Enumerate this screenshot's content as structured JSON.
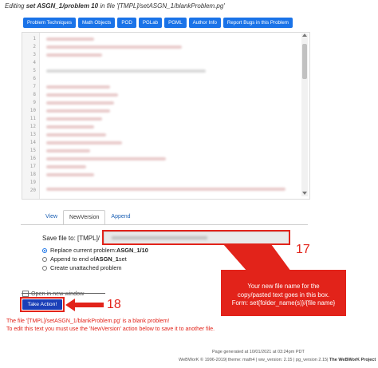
{
  "header": {
    "prefix": "Editing",
    "problem": "set ASGN_1/problem 10",
    "mid": "in file",
    "file": "'[TMPL]/setASGN_1/blankProblem.pg'"
  },
  "toolbar": {
    "buttons": [
      "Problem Techniques",
      "Math Objects",
      "POD",
      "PGLab",
      "PGML",
      "Author Info",
      "Report Bugs in this Problem"
    ]
  },
  "editor": {
    "line_numbers": [
      "1",
      "2",
      "3",
      "4",
      "5",
      "6",
      "7",
      "8",
      "9",
      "10",
      "11",
      "12",
      "13",
      "14",
      "15",
      "16",
      "17",
      "18",
      "19",
      "20"
    ]
  },
  "tabs": [
    "View",
    "NewVersion",
    "Append"
  ],
  "active_tab": "NewVersion",
  "save": {
    "label": "Save file to: [TMPL]/"
  },
  "options": {
    "replace_prefix": "Replace current problem: ",
    "replace_target": "ASGN_1/10",
    "append_prefix": "Append to end of ",
    "append_target": "ASGN_1",
    "append_suffix": " set",
    "create": "Create unattached problem"
  },
  "open_new_window": "Open in new window",
  "action_button": "Take Action!",
  "annotations": {
    "callout": [
      "Your new file name for the",
      "copy/pasted text goes in this box.",
      "Form: set{folder_name(s)}/{file name}"
    ],
    "marker_17": "17",
    "marker_18": "18",
    "accent": "#e2231a"
  },
  "messages": {
    "line1": "The file '[TMPL]/setASGN_1/blankProblem.pg' is a blank problem!",
    "line2": "To edit this text you must use the 'NewVersion' action below to save it to another file."
  },
  "footer": {
    "generated": "Page generated at 10/01/2021 at 03:24pm PDT",
    "copyright": "WeBWorK © 1996-2019| theme: math4 | ww_version: 2.15 | pg_version 2.15|",
    "project": "The WeBWorK Project"
  }
}
